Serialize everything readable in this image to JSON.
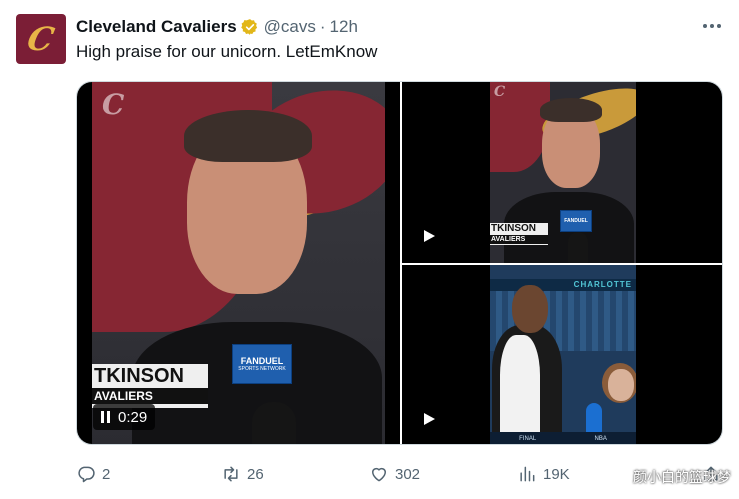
{
  "tweet": {
    "author_name": "Cleveland Cavaliers",
    "handle": "@cavs",
    "separator": "·",
    "time": "12h",
    "text": "High praise for our unicorn. LetEmKnow",
    "avatar_icon": "cavaliers-c-logo",
    "verified_icon": "verified-badge-icon",
    "more_icon": "more-dots-icon"
  },
  "media": {
    "main": {
      "lower_third_name": "TKINSON",
      "lower_third_team": "AVALIERS",
      "mic_flag_brand": "FANDUEL",
      "mic_flag_sub": "SPORTS NETWORK",
      "duration": "0:29",
      "state_icon": "pause-icon"
    },
    "top_right": {
      "lower_third_name": "TKINSON",
      "lower_third_team": "AVALIERS",
      "mic_flag_brand": "FANDUEL",
      "state_icon": "play-icon"
    },
    "bottom_right": {
      "arena_banner": "CHARLOTTE",
      "score_final": "FINAL",
      "score_nba": "NBA",
      "state_icon": "play-icon"
    }
  },
  "actions": {
    "reply_count": "2",
    "retweet_count": "26",
    "like_count": "302",
    "views_count": "19K"
  },
  "watermark": "颜小白的篮球梦",
  "colors": {
    "text_primary": "#0f1419",
    "text_secondary": "#536471",
    "verified_gold": "#e2b719",
    "cavs_wine": "#862633",
    "cavs_gold": "#c99a3a"
  }
}
